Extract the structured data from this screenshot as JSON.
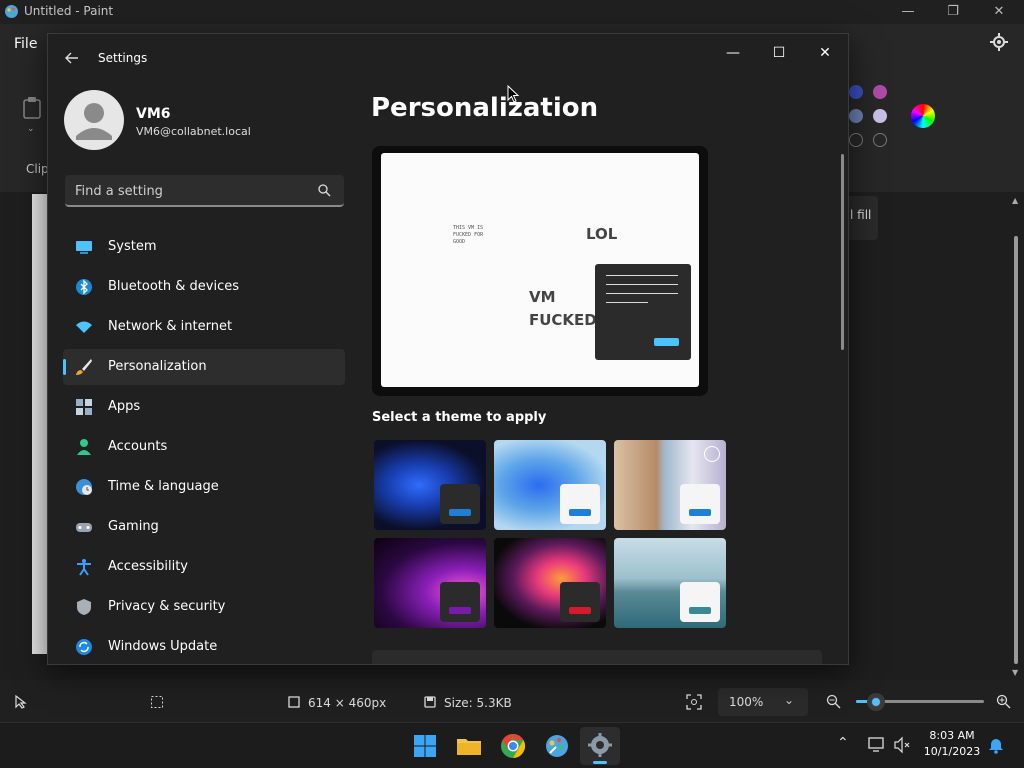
{
  "paint": {
    "title": "Untitled - Paint",
    "menu_file": "File",
    "clipboard_label": "Clip",
    "fill_label": "l fill",
    "status": {
      "canvas_size": "614 × 460px",
      "file_size": "Size: 5.3KB",
      "zoom": "100%"
    },
    "swatches": [
      "#3b4cc0",
      "#b04aa5",
      "#6a7fb0",
      "#c9bfe8"
    ]
  },
  "settings": {
    "title": "Settings",
    "user": {
      "name": "VM6",
      "email": "VM6@collabnet.local"
    },
    "search_placeholder": "Find a setting",
    "nav": [
      {
        "label": "System",
        "icon": "monitor-icon"
      },
      {
        "label": "Bluetooth & devices",
        "icon": "bluetooth-icon"
      },
      {
        "label": "Network & internet",
        "icon": "wifi-icon"
      },
      {
        "label": "Personalization",
        "icon": "brush-icon",
        "active": true
      },
      {
        "label": "Apps",
        "icon": "apps-icon"
      },
      {
        "label": "Accounts",
        "icon": "person-icon"
      },
      {
        "label": "Time & language",
        "icon": "globe-clock-icon"
      },
      {
        "label": "Gaming",
        "icon": "gamepad-icon"
      },
      {
        "label": "Accessibility",
        "icon": "accessibility-icon"
      },
      {
        "label": "Privacy & security",
        "icon": "shield-icon"
      },
      {
        "label": "Windows Update",
        "icon": "update-icon"
      }
    ],
    "page_title": "Personalization",
    "preview": {
      "small_text_line1": "THIS VM IS",
      "small_text_line2": "FUCKED FOR",
      "small_text_line3": "GOOD",
      "big_text": "LOL",
      "center_line1": "VM",
      "center_line2": "FUCKED"
    },
    "theme_heading": "Select a theme to apply",
    "accent": "#4cc2ff"
  },
  "taskbar": {
    "time": "8:03 AM",
    "date": "10/1/2023"
  }
}
